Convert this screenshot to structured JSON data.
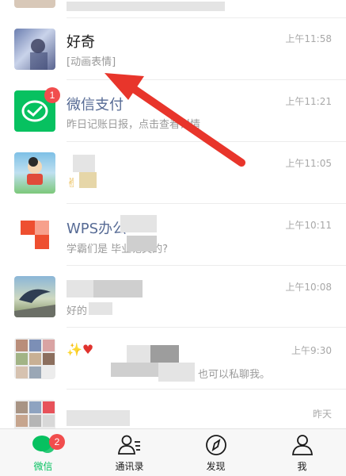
{
  "chats": [
    {
      "name": "",
      "preview": "",
      "time": ""
    },
    {
      "name": "好奇",
      "preview": "[动画表情]",
      "time": "上午11:58"
    },
    {
      "name": "微信支付",
      "preview": "昨日记账日报，点击查看详情",
      "time": "上午11:21",
      "badge": "1"
    },
    {
      "name": "",
      "preview": "",
      "time": "上午11:05"
    },
    {
      "name": "WPS办公",
      "preview": "学霸们是       毕业论文的?",
      "time": "上午10:11"
    },
    {
      "name": "",
      "preview": "好的",
      "time": "上午10:08"
    },
    {
      "name": "",
      "preview": "也可以私聊我。",
      "time": "上午9:30"
    },
    {
      "name": "",
      "preview": "",
      "time": "昨天"
    }
  ],
  "tabs": [
    {
      "label": "微信",
      "icon": "chat-bubbles-icon",
      "badge": "2",
      "active": true
    },
    {
      "label": "通讯录",
      "icon": "contacts-icon"
    },
    {
      "label": "发现",
      "icon": "compass-icon"
    },
    {
      "label": "我",
      "icon": "person-icon"
    }
  ],
  "colors": {
    "accent": "#07c160",
    "badge": "#f14d4d",
    "arrow": "#e8352b"
  }
}
